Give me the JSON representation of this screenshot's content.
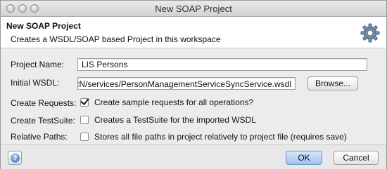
{
  "window": {
    "title": "New SOAP Project"
  },
  "banner": {
    "title": "New SOAP Project",
    "description": "Creates a WSDL/SOAP based Project in this workspace",
    "icon": "gear-icon"
  },
  "form": {
    "project_name": {
      "label": "Project Name:",
      "value": "LIS Persons"
    },
    "initial_wsdl": {
      "label": "Initial WSDL:",
      "value": "/RN/services/PersonManagementServiceSyncService.wsdl",
      "browse_label": "Browse..."
    },
    "create_requests": {
      "label": "Create Requests:",
      "checked": true,
      "text": "Create sample requests for all operations?"
    },
    "create_testsuite": {
      "label": "Create TestSuite:",
      "checked": false,
      "text": "Creates a TestSuite for the imported WSDL"
    },
    "relative_paths": {
      "label": "Relative Paths:",
      "checked": false,
      "text": "Stores all file paths in project relatively to project file (requires save)"
    }
  },
  "footer": {
    "help_icon": "help-icon",
    "ok_label": "OK",
    "cancel_label": "Cancel"
  }
}
